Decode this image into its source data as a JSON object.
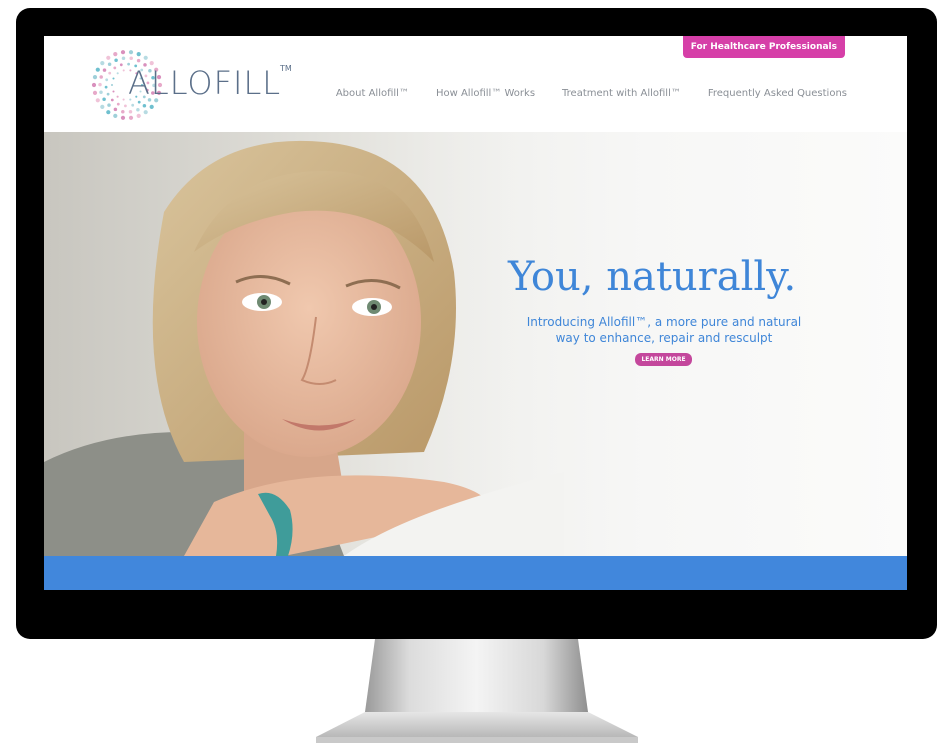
{
  "header": {
    "logo_text": "ALLOFILL",
    "logo_tm": "TM",
    "healthcare_button": "For Healthcare Professionals",
    "nav": [
      {
        "label": "About Allofill™"
      },
      {
        "label": "How Allofill™ Works"
      },
      {
        "label": "Treatment with Allofill™"
      },
      {
        "label": "Frequently Asked Questions"
      }
    ]
  },
  "hero": {
    "title": "You, naturally.",
    "subtitle_line1": "Introducing Allofill™, a more pure and natural",
    "subtitle_line2": "way to enhance, repair and resculpt",
    "cta": "LEARN MORE"
  },
  "colors": {
    "accent_blue": "#4187dc",
    "pink": "#d63fa8",
    "logo_gray": "#5b6f89"
  }
}
